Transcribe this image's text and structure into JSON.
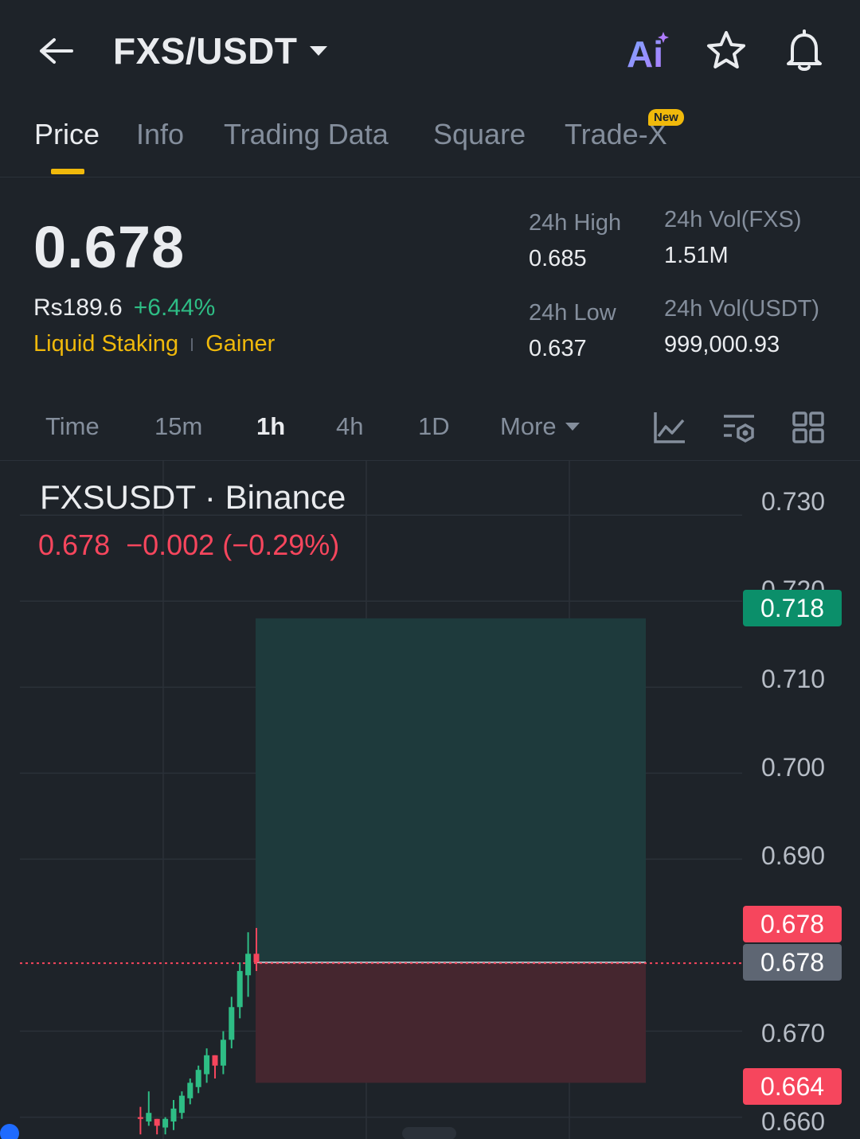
{
  "header": {
    "pair": "FXS/USDT",
    "ai_label": "Ai"
  },
  "tabs": [
    {
      "label": "Price",
      "active": true
    },
    {
      "label": "Info"
    },
    {
      "label": "Trading Data"
    },
    {
      "label": "Square"
    },
    {
      "label": "Trade-X",
      "badge": "New"
    }
  ],
  "price": {
    "last": "0.678",
    "fiat": "Rs189.6",
    "change_pct": "+6.44%",
    "tags": [
      "Liquid Staking",
      "Gainer"
    ]
  },
  "stats": {
    "high_label": "24h High",
    "high_value": "0.685",
    "low_label": "24h Low",
    "low_value": "0.637",
    "vol_base_label": "24h Vol(FXS)",
    "vol_base_value": "1.51M",
    "vol_quote_label": "24h Vol(USDT)",
    "vol_quote_value": "999,000.93"
  },
  "intervals": {
    "items": [
      "Time",
      "15m",
      "1h",
      "4h",
      "1D"
    ],
    "active": "1h",
    "more": "More"
  },
  "chart": {
    "symbol_title": "FXSUSDT · Binance",
    "legend_price": "0.678",
    "legend_change": "−0.002 (−0.29%)",
    "badges": {
      "target": "0.718",
      "current_red": "0.678",
      "current_gray": "0.678",
      "stop": "0.664"
    }
  },
  "chart_data": {
    "type": "candlestick",
    "y_ticks": [
      "0.730",
      "0.720",
      "0.710",
      "0.700",
      "0.690",
      "0.678",
      "0.670",
      "0.660"
    ],
    "ylim": [
      0.6595,
      0.7315
    ],
    "last_price": 0.678,
    "position": {
      "entry": 0.678,
      "target": 0.718,
      "stop": 0.664
    },
    "candles": [
      {
        "o": 0.6598,
        "h": 0.6612,
        "l": 0.658,
        "c": 0.66,
        "dir": "down"
      },
      {
        "o": 0.6595,
        "h": 0.663,
        "l": 0.659,
        "c": 0.6605,
        "dir": "up"
      },
      {
        "o": 0.6598,
        "h": 0.6598,
        "l": 0.658,
        "c": 0.659,
        "dir": "down"
      },
      {
        "o": 0.6588,
        "h": 0.66,
        "l": 0.658,
        "c": 0.6598,
        "dir": "up"
      },
      {
        "o": 0.6595,
        "h": 0.662,
        "l": 0.6585,
        "c": 0.661,
        "dir": "up"
      },
      {
        "o": 0.6605,
        "h": 0.663,
        "l": 0.6598,
        "c": 0.6625,
        "dir": "up"
      },
      {
        "o": 0.6622,
        "h": 0.6645,
        "l": 0.6615,
        "c": 0.664,
        "dir": "up"
      },
      {
        "o": 0.6635,
        "h": 0.666,
        "l": 0.6628,
        "c": 0.6655,
        "dir": "up"
      },
      {
        "o": 0.665,
        "h": 0.668,
        "l": 0.664,
        "c": 0.6672,
        "dir": "up"
      },
      {
        "o": 0.6672,
        "h": 0.6665,
        "l": 0.6645,
        "c": 0.666,
        "dir": "down"
      },
      {
        "o": 0.666,
        "h": 0.67,
        "l": 0.665,
        "c": 0.669,
        "dir": "up"
      },
      {
        "o": 0.669,
        "h": 0.674,
        "l": 0.668,
        "c": 0.6728,
        "dir": "up"
      },
      {
        "o": 0.6728,
        "h": 0.678,
        "l": 0.6715,
        "c": 0.677,
        "dir": "up"
      },
      {
        "o": 0.6765,
        "h": 0.6815,
        "l": 0.674,
        "c": 0.679,
        "dir": "up"
      },
      {
        "o": 0.679,
        "h": 0.682,
        "l": 0.677,
        "c": 0.678,
        "dir": "down"
      }
    ]
  }
}
